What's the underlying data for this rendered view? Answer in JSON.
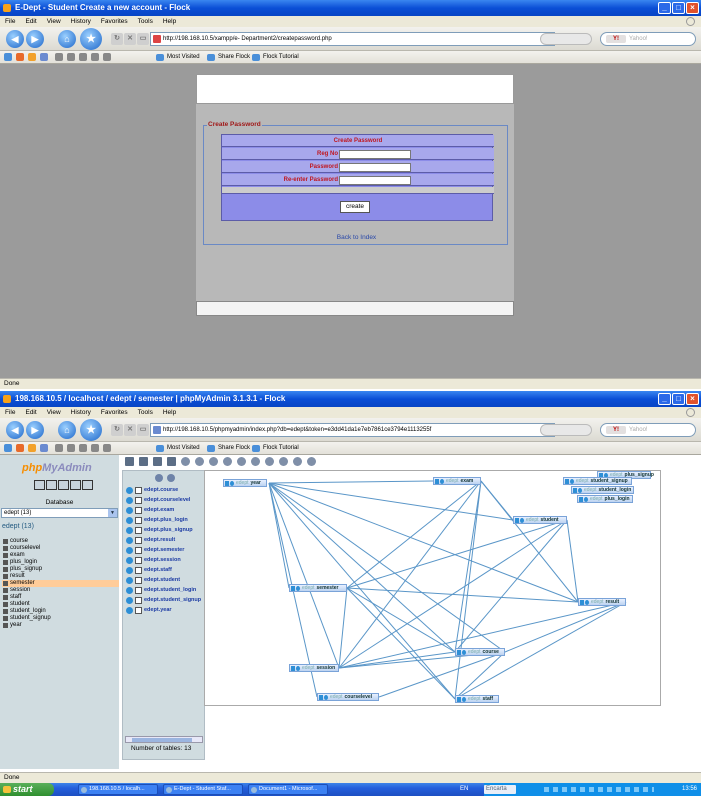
{
  "window1": {
    "title": "E-Dept - Student Create a new account - Flock",
    "menu": [
      "File",
      "Edit",
      "View",
      "History",
      "Favorites",
      "Tools",
      "Help"
    ],
    "url": "http://198.168.10.5/xampp/e- Department2/createpassword.php",
    "search_placeholder": "Yahoo!",
    "bookmarks": [
      "Most Visited",
      "Share Flock",
      "Flock Tutorial"
    ],
    "form": {
      "legend": "Create Password",
      "header": "Create Password",
      "regno_label": "Reg No",
      "password_label": "Password",
      "reenter_label": "Re-enter Password",
      "create_button": "create",
      "back_link": "Back to Index"
    },
    "status": "Done"
  },
  "window2": {
    "title": "198.168.10.5 / localhost / edept / semester | phpMyAdmin 3.1.3.1 - Flock",
    "menu": [
      "File",
      "Edit",
      "View",
      "History",
      "Favorites",
      "Tools",
      "Help"
    ],
    "url": "http://198.168.10.5/phpmyadmin/index.php?db=edept&token=e3dd41da1e7eb7861ce3794e1113255f",
    "search_placeholder": "Yahoo!",
    "bookmarks": [
      "Most Visited",
      "Share Flock",
      "Flock Tutorial"
    ],
    "pma": {
      "logo_php": "php",
      "logo_myadmin": "MyAdmin",
      "database_label": "Database",
      "db_select": "edept (13)",
      "db_name": "edept (13)",
      "tables": [
        "course",
        "courselevel",
        "exam",
        "plus_login",
        "plus_signup",
        "result",
        "semester",
        "session",
        "staff",
        "student",
        "student_login",
        "student_signup",
        "year"
      ],
      "selected_table": "semester",
      "designer_tables": [
        "edept.course",
        "edept.courselevel",
        "edept.exam",
        "edept.plus_login",
        "edept.plus_signup",
        "edept.result",
        "edept.semester",
        "edept.session",
        "edept.staff",
        "edept.student",
        "edept.student_login",
        "edept.student_signup",
        "edept.year"
      ],
      "number_of_tables": "Number of tables: 13",
      "canvas_prefix": "edept",
      "canvas_tables": [
        "year",
        "exam",
        "student",
        "semester",
        "result",
        "course",
        "session",
        "courselevel",
        "staff",
        "plus_signup",
        "student_signup",
        "student_login",
        "plus_login"
      ]
    },
    "status": "Done"
  },
  "taskbar": {
    "start": "start",
    "items": [
      "198.168.10.5 / localh...",
      "E-Dept - Student Staf...",
      "Document1 - Microsof..."
    ],
    "lang": "EN",
    "encarta": "Encarta",
    "clock": "13:56"
  }
}
